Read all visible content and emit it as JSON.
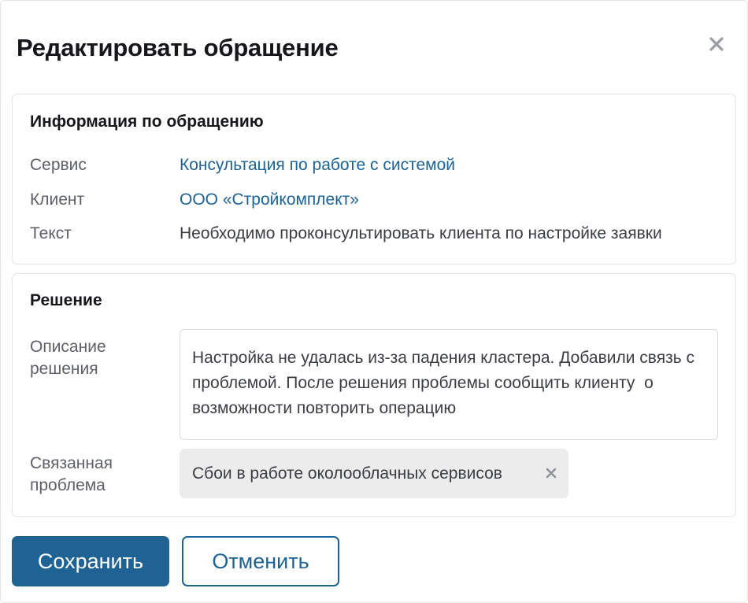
{
  "dialog": {
    "title": "Редактировать обращение"
  },
  "icons": {
    "close": "close-icon",
    "tag_remove": "remove-tag-icon"
  },
  "info_section": {
    "title": "Информация по обращению",
    "rows": [
      {
        "label": "Сервис",
        "value": "Консультация по работе с системой",
        "is_link": true
      },
      {
        "label": "Клиент",
        "value": "ООО «Стройкомплект»",
        "is_link": true
      },
      {
        "label": "Текст",
        "value": "Необходимо проконсультировать клиента по настройке заявки",
        "is_link": false
      }
    ]
  },
  "solution_section": {
    "title": "Решение",
    "description_label": "Описание решения",
    "description_value": "Настройка не удалась из-за падения кластера. Добавили связь с проблемой. После решения проблемы сообщить клиенту  о возможности повторить операцию",
    "related_label": "Связанная проблема",
    "related_problem": "Сбои в работе околооблачных сервисов"
  },
  "actions": {
    "save_label": "Сохранить",
    "cancel_label": "Отменить"
  },
  "colors": {
    "link": "#1d6397",
    "primary_button": "#1f6394",
    "tag_background": "#ececed",
    "border": "#e2e4e8"
  }
}
